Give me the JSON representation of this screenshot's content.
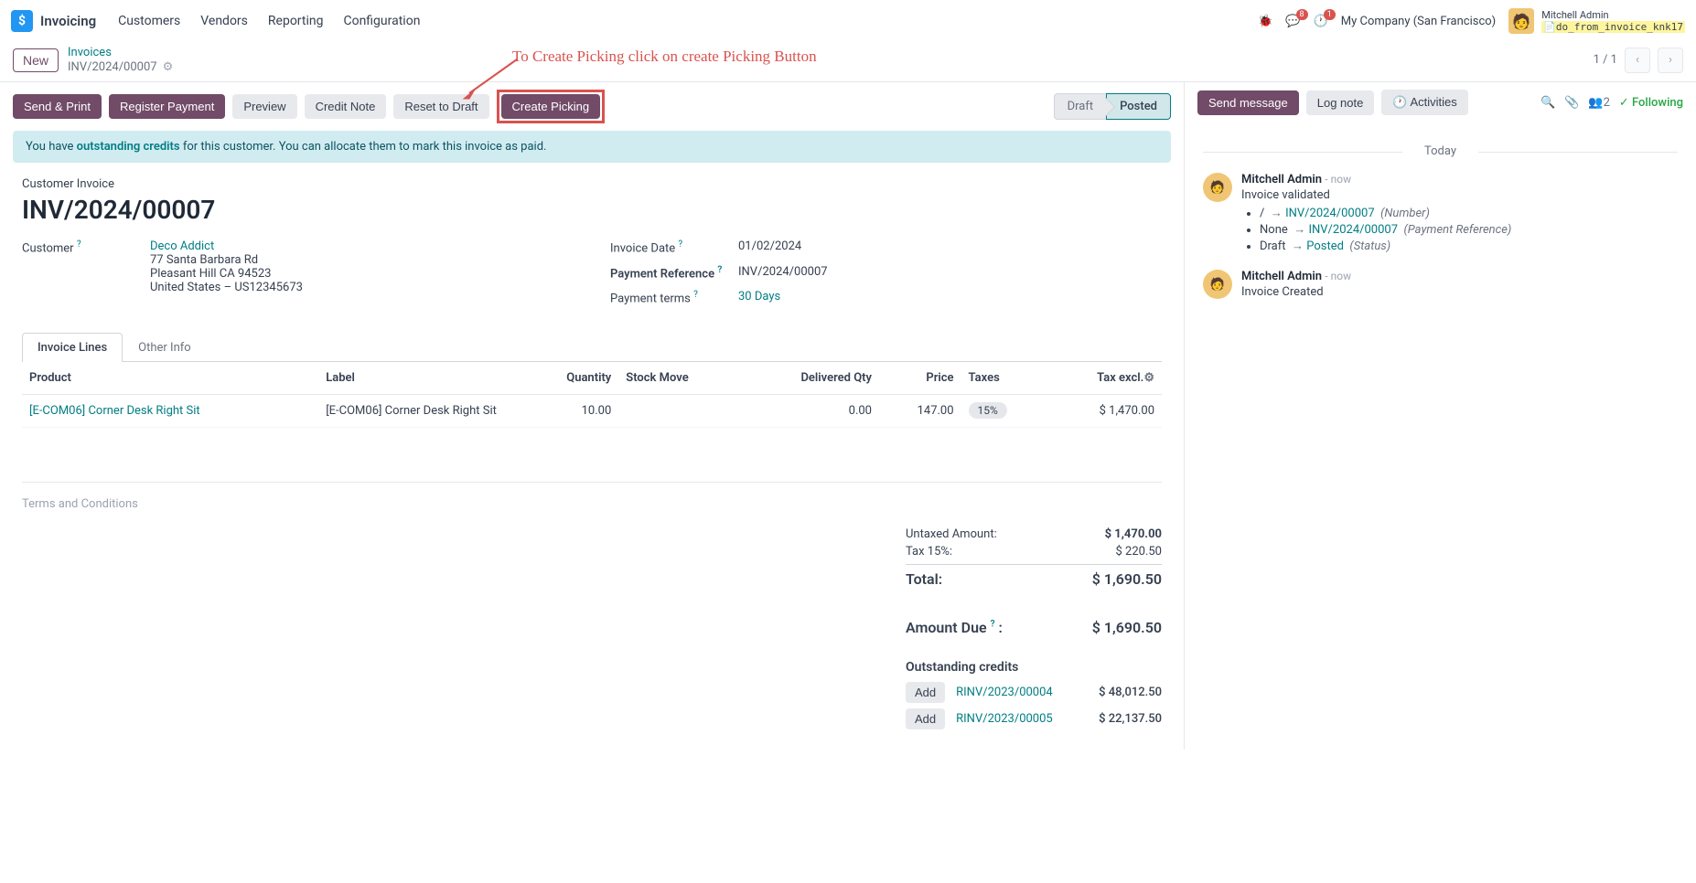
{
  "nav": {
    "app": "Invoicing",
    "items": [
      "Customers",
      "Vendors",
      "Reporting",
      "Configuration"
    ],
    "msg_count": "8",
    "clock_count": "1",
    "company": "My Company (San Francisco)",
    "user_name": "Mitchell Admin",
    "user_db": "do_from_invoice_knk17"
  },
  "control": {
    "new": "New",
    "breadcrumb_root": "Invoices",
    "breadcrumb_current": "INV/2024/00007",
    "pager": "1 / 1"
  },
  "buttons": {
    "send_print": "Send & Print",
    "register_payment": "Register Payment",
    "preview": "Preview",
    "credit_note": "Credit Note",
    "reset_to_draft": "Reset to Draft",
    "create_picking": "Create Picking"
  },
  "stages": {
    "draft": "Draft",
    "posted": "Posted"
  },
  "alert": {
    "pre": "You have ",
    "link": "outstanding credits",
    "post": " for this customer. You can allocate them to mark this invoice as paid."
  },
  "annotation": "To Create Picking click on create Picking Button",
  "sheet": {
    "title_label": "Customer Invoice",
    "title": "INV/2024/00007",
    "customer_label": "Customer",
    "customer_name": "Deco Addict",
    "customer_addr1": "77 Santa Barbara Rd",
    "customer_addr2": "Pleasant Hill CA 94523",
    "customer_addr3": "United States – US12345673",
    "invoice_date_label": "Invoice Date",
    "invoice_date": "01/02/2024",
    "payment_ref_label": "Payment Reference",
    "payment_ref": "INV/2024/00007",
    "payment_terms_label": "Payment terms",
    "payment_terms": "30 Days"
  },
  "tabs": {
    "lines": "Invoice Lines",
    "other": "Other Info"
  },
  "table": {
    "headers": {
      "product": "Product",
      "label": "Label",
      "quantity": "Quantity",
      "stock_move": "Stock Move",
      "delivered_qty": "Delivered Qty",
      "price": "Price",
      "taxes": "Taxes",
      "tax_excl": "Tax excl."
    },
    "rows": [
      {
        "product": "[E-COM06] Corner Desk Right Sit",
        "label": "[E-COM06] Corner Desk Right Sit",
        "quantity": "10.00",
        "stock_move": "",
        "delivered_qty": "0.00",
        "price": "147.00",
        "taxes": "15%",
        "tax_excl": "$ 1,470.00"
      }
    ]
  },
  "terms_placeholder": "Terms and Conditions",
  "totals": {
    "untaxed_label": "Untaxed Amount:",
    "untaxed": "$ 1,470.00",
    "tax_label": "Tax 15%:",
    "tax": "$ 220.50",
    "total_label": "Total:",
    "total": "$ 1,690.50",
    "due_label": "Amount Due",
    "due_suffix": ":",
    "due": "$ 1,690.50"
  },
  "outstanding": {
    "title": "Outstanding credits",
    "add": "Add",
    "rows": [
      {
        "ref": "RINV/2023/00004",
        "amount": "$ 48,012.50"
      },
      {
        "ref": "RINV/2023/00005",
        "amount": "$ 22,137.50"
      }
    ]
  },
  "chatter": {
    "send": "Send message",
    "log": "Log note",
    "activities": "Activities",
    "follower_count": "2",
    "following": "Following",
    "today": "Today",
    "msg1": {
      "author": "Mitchell Admin",
      "time": "now",
      "subject": "Invoice validated",
      "c1_pre": "/",
      "c1_link": "INV/2024/00007",
      "c1_note": "(Number)",
      "c2_pre": "None",
      "c2_link": "INV/2024/00007",
      "c2_note": "(Payment Reference)",
      "c3_pre": "Draft",
      "c3_link": "Posted",
      "c3_note": "(Status)"
    },
    "msg2": {
      "author": "Mitchell Admin",
      "time": "now",
      "text": "Invoice Created"
    }
  }
}
